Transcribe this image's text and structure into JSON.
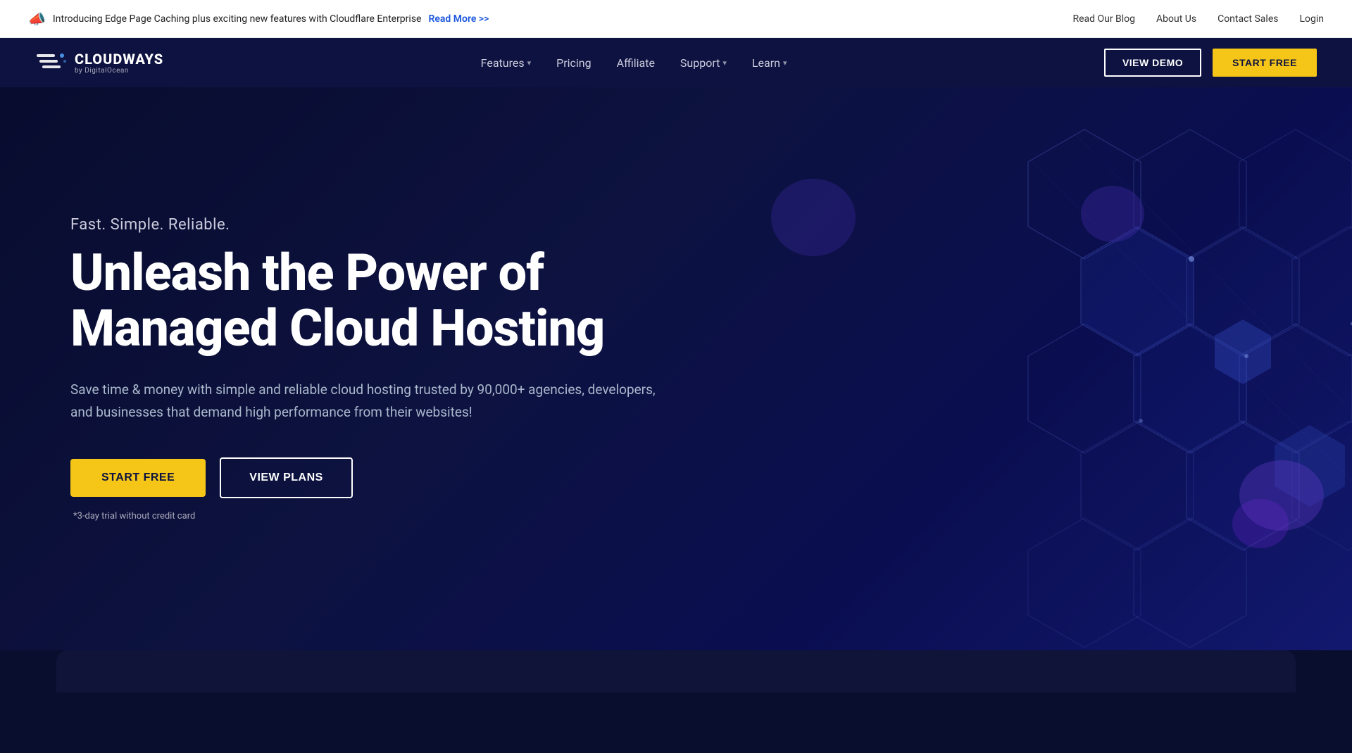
{
  "topbar": {
    "announcement": "Introducing Edge Page Caching plus exciting new features with Cloudflare Enterprise",
    "read_more_label": "Read More >>",
    "links": [
      {
        "label": "Read Our Blog",
        "id": "read-blog"
      },
      {
        "label": "About Us",
        "id": "about-us"
      },
      {
        "label": "Contact Sales",
        "id": "contact-sales"
      },
      {
        "label": "Login",
        "id": "login"
      }
    ]
  },
  "nav": {
    "brand_name": "CLOUDWAYS",
    "brand_sub": "by DigitalOcean",
    "links": [
      {
        "label": "Features",
        "has_dropdown": true
      },
      {
        "label": "Pricing",
        "has_dropdown": false
      },
      {
        "label": "Affiliate",
        "has_dropdown": false
      },
      {
        "label": "Support",
        "has_dropdown": true
      },
      {
        "label": "Learn",
        "has_dropdown": true
      }
    ],
    "view_demo_label": "VIEW DEMO",
    "start_free_label": "START FREE"
  },
  "hero": {
    "tagline": "Fast. Simple. Reliable.",
    "headline": "Unleash the Power of\nManaged Cloud Hosting",
    "description": "Save time & money with simple and reliable cloud hosting trusted by 90,000+ agencies, developers, and businesses that demand high performance from their websites!",
    "start_free_label": "START FREE",
    "view_plans_label": "VIEW PLANS",
    "trial_note": "*3-day trial without credit card"
  },
  "colors": {
    "accent_yellow": "#f5c518",
    "nav_bg": "#0d1240",
    "hero_bg": "#080c2e",
    "brand_blue": "#1a56db"
  }
}
